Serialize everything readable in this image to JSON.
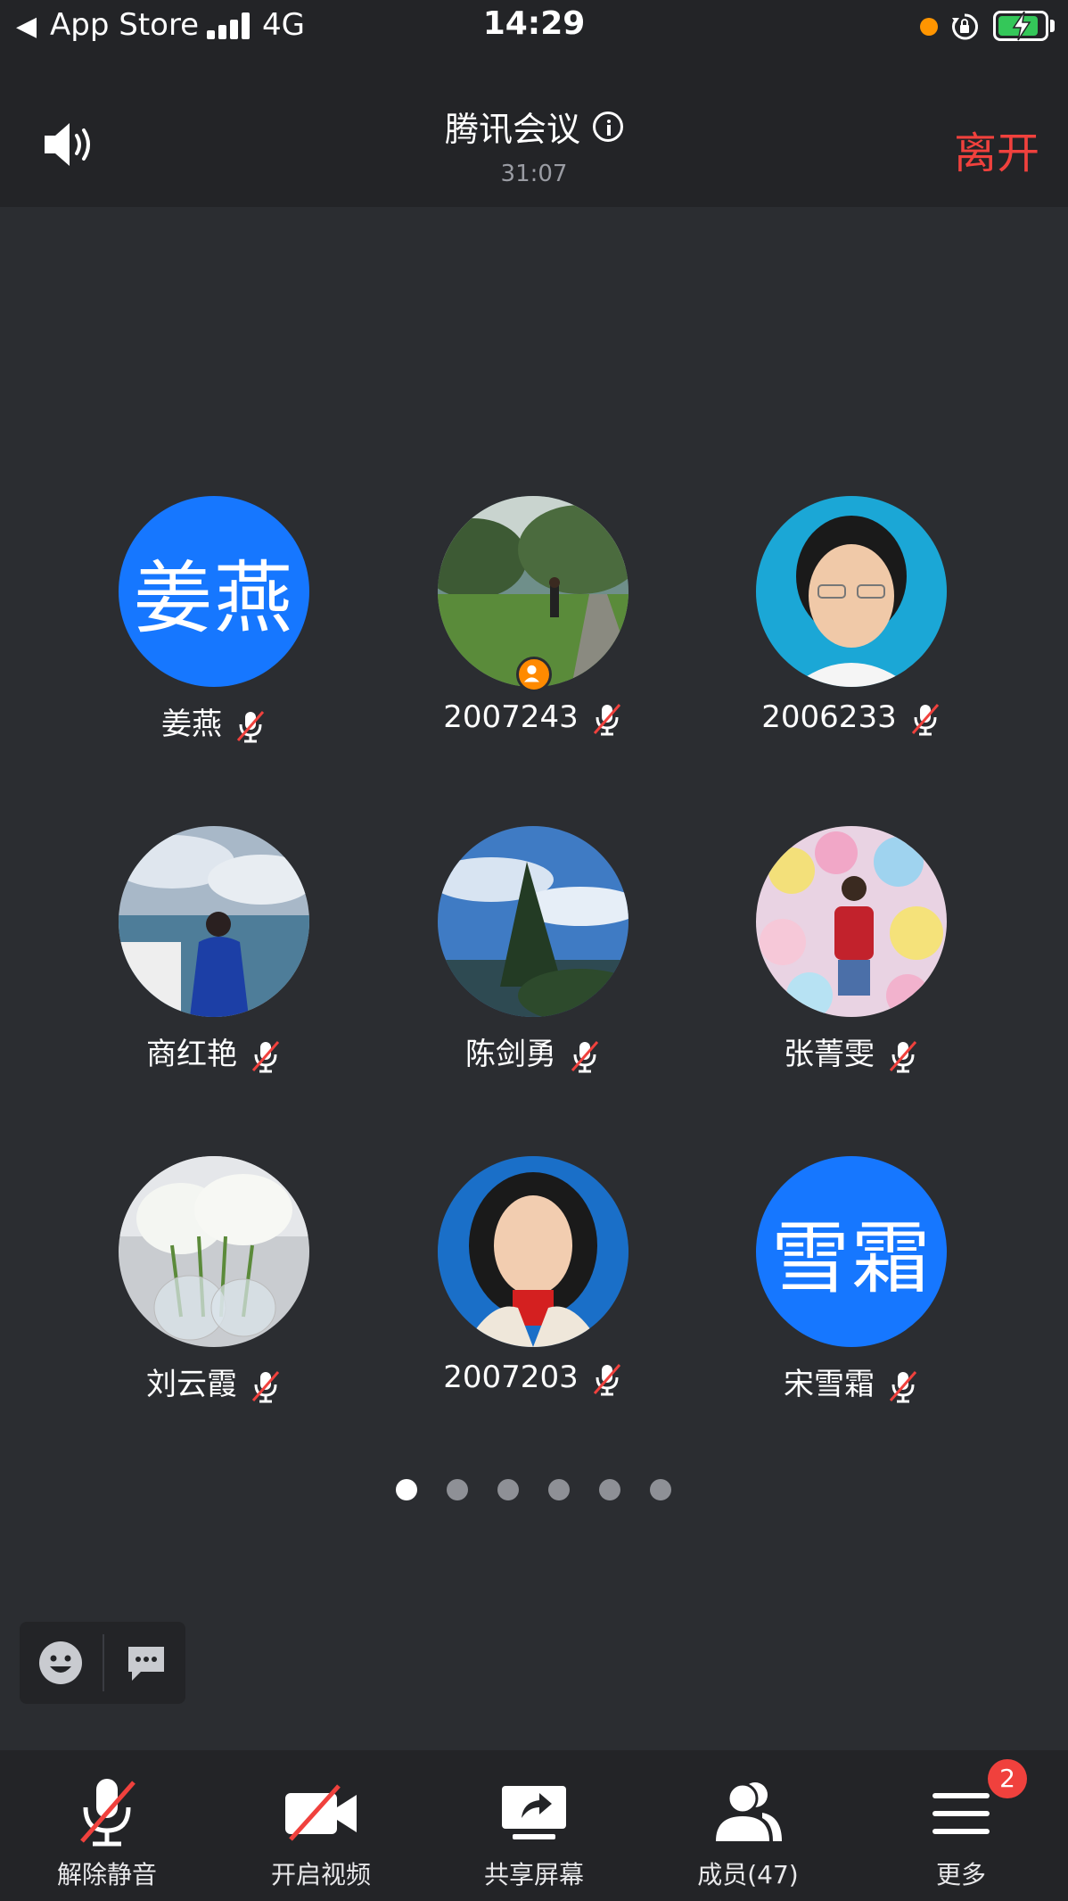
{
  "status_bar": {
    "back_app": "App Store",
    "network": "4G",
    "time": "14:29"
  },
  "header": {
    "title": "腾讯会议",
    "timer": "31:07",
    "leave_label": "离开"
  },
  "participants": [
    {
      "name": "姜燕",
      "avatar_type": "text",
      "avatar_text": "姜燕",
      "muted": true
    },
    {
      "name": "2007243",
      "avatar_type": "photo",
      "host": true,
      "muted": true
    },
    {
      "name": "2006233",
      "avatar_type": "photo",
      "muted": true
    },
    {
      "name": "商红艳",
      "avatar_type": "photo",
      "muted": true
    },
    {
      "name": "陈剑勇",
      "avatar_type": "photo",
      "muted": true
    },
    {
      "name": "张菁雯",
      "avatar_type": "photo",
      "muted": true
    },
    {
      "name": "刘云霞",
      "avatar_type": "photo",
      "muted": true
    },
    {
      "name": "2007203",
      "avatar_type": "photo",
      "muted": true
    },
    {
      "name": "宋雪霜",
      "avatar_type": "text",
      "avatar_text": "雪霜",
      "muted": true
    }
  ],
  "pagination": {
    "pages": 6,
    "current": 1
  },
  "toolbar": {
    "unmute_label": "解除静音",
    "video_label": "开启视频",
    "share_label": "共享屏幕",
    "members_label": "成员(47)",
    "more_label": "更多",
    "more_badge": "2"
  },
  "colors": {
    "background": "#2b2d31",
    "bar": "#232427",
    "accent_blue": "#1677ff",
    "leave_red": "#f0413d",
    "host_orange": "#ff8a00"
  }
}
